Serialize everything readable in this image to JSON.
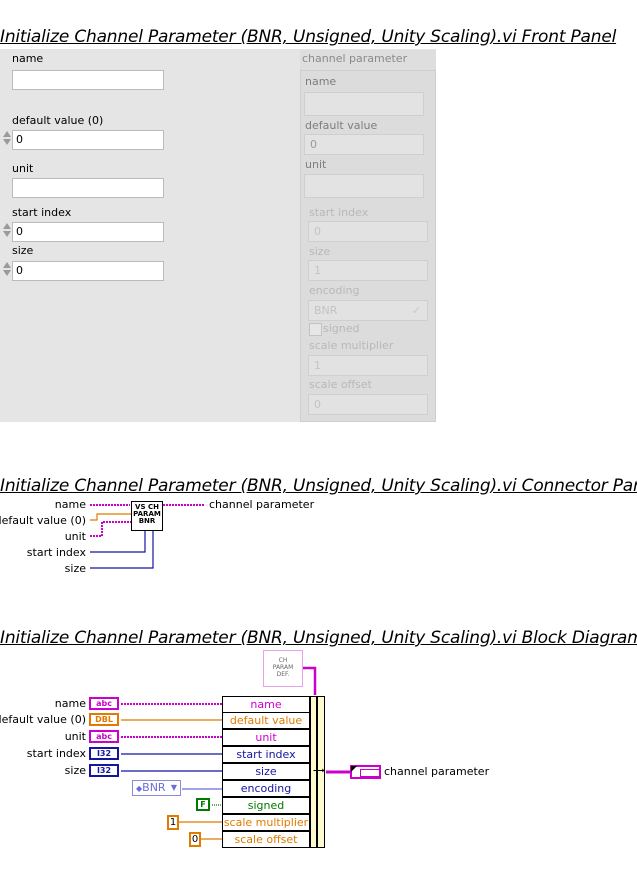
{
  "titles": {
    "front_panel": "Initialize Channel Parameter (BNR, Unsigned, Unity Scaling).vi Front Panel",
    "connector_pane": "Initialize Channel Parameter (BNR, Unsigned, Unity Scaling).vi Connector Pane",
    "block_diagram": "Initialize Channel Parameter (BNR, Unsigned, Unity Scaling).vi Block Diagram"
  },
  "front_panel": {
    "controls": {
      "name": {
        "label": "name",
        "value": ""
      },
      "default_value": {
        "label": "default value (0)",
        "value": "0"
      },
      "unit": {
        "label": "unit",
        "value": ""
      },
      "start_index": {
        "label": "start index",
        "value": "0"
      },
      "size": {
        "label": "size",
        "value": "0"
      }
    },
    "cluster": {
      "label": "channel parameter",
      "name": {
        "label": "name",
        "value": ""
      },
      "default_value": {
        "label": "default value",
        "value": "0"
      },
      "unit": {
        "label": "unit",
        "value": ""
      },
      "start_index": {
        "label": "start index",
        "value": "0"
      },
      "size": {
        "label": "size",
        "value": "1"
      },
      "encoding": {
        "label": "encoding",
        "value": "BNR"
      },
      "signed": {
        "label": "signed",
        "checked": false
      },
      "scale_multiplier": {
        "label": "scale multiplier",
        "value": "1"
      },
      "scale_offset": {
        "label": "scale offset",
        "value": "0"
      }
    }
  },
  "connector_pane": {
    "inputs": [
      "name",
      "default value (0)",
      "unit",
      "start index",
      "size"
    ],
    "output": "channel parameter",
    "icon_text": [
      "VS CH",
      "PARAM",
      "BNR"
    ]
  },
  "block_diagram": {
    "inputs": [
      {
        "label": "name",
        "type": "abc"
      },
      {
        "label": "default value (0)",
        "type": "DBL"
      },
      {
        "label": "unit",
        "type": "abc"
      },
      {
        "label": "start index",
        "type": "I32"
      },
      {
        "label": "size",
        "type": "I32"
      }
    ],
    "constant_icon": [
      "CH",
      "PARAM",
      "DEF."
    ],
    "bundle_fields": [
      "name",
      "default value",
      "unit",
      "start index",
      "size",
      "encoding",
      "signed",
      "scale multiplier",
      "scale offset"
    ],
    "enum_constant": "BNR",
    "bool_constant": "F",
    "multiplier_constant": "1",
    "offset_constant": "0",
    "output_label": "channel parameter",
    "colors": {
      "string": "#cc00cc",
      "double": "#e07b00",
      "int": "#1515a0",
      "bool": "#007a00",
      "enum": "#6b6bd6"
    }
  }
}
